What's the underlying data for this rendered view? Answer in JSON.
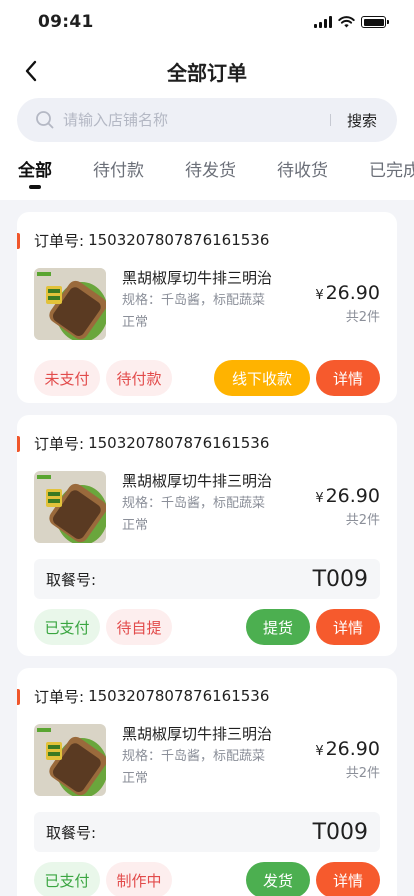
{
  "status": {
    "time": "09:41"
  },
  "nav": {
    "title": "全部订单"
  },
  "search": {
    "placeholder": "请输入店铺名称",
    "button": "搜索"
  },
  "tabs": [
    "全部",
    "待付款",
    "待发货",
    "待收货",
    "已完成"
  ],
  "colors": {
    "accent": "#f0562b",
    "orange": "#ffb300",
    "red_btn": "#f65a2d",
    "green_btn": "#4caf50"
  },
  "orders": [
    {
      "order_label": "订单号:",
      "order_no": "1503207807876161536",
      "product": "黑胡椒厚切牛排三明治",
      "spec": "规格：千岛酱，标配蔬菜",
      "state": "正常",
      "price_symbol": "¥",
      "price": "26.90",
      "count": "共2件",
      "tags": [
        "未支付",
        "待付款"
      ],
      "buttons": [
        "线下收款",
        "详情"
      ]
    },
    {
      "order_label": "订单号:",
      "order_no": "1503207807876161536",
      "product": "黑胡椒厚切牛排三明治",
      "spec": "规格：千岛酱，标配蔬菜",
      "state": "正常",
      "price_symbol": "¥",
      "price": "26.90",
      "count": "共2件",
      "pickup_label": "取餐号:",
      "pickup_no": "T009",
      "tags": [
        "已支付",
        "待自提"
      ],
      "buttons": [
        "提货",
        "详情"
      ]
    },
    {
      "order_label": "订单号:",
      "order_no": "1503207807876161536",
      "product": "黑胡椒厚切牛排三明治",
      "spec": "规格：千岛酱，标配蔬菜",
      "state": "正常",
      "price_symbol": "¥",
      "price": "26.90",
      "count": "共2件",
      "pickup_label": "取餐号:",
      "pickup_no": "T009",
      "tags": [
        "已支付",
        "制作中"
      ],
      "buttons": [
        "发货",
        "详情"
      ]
    }
  ]
}
